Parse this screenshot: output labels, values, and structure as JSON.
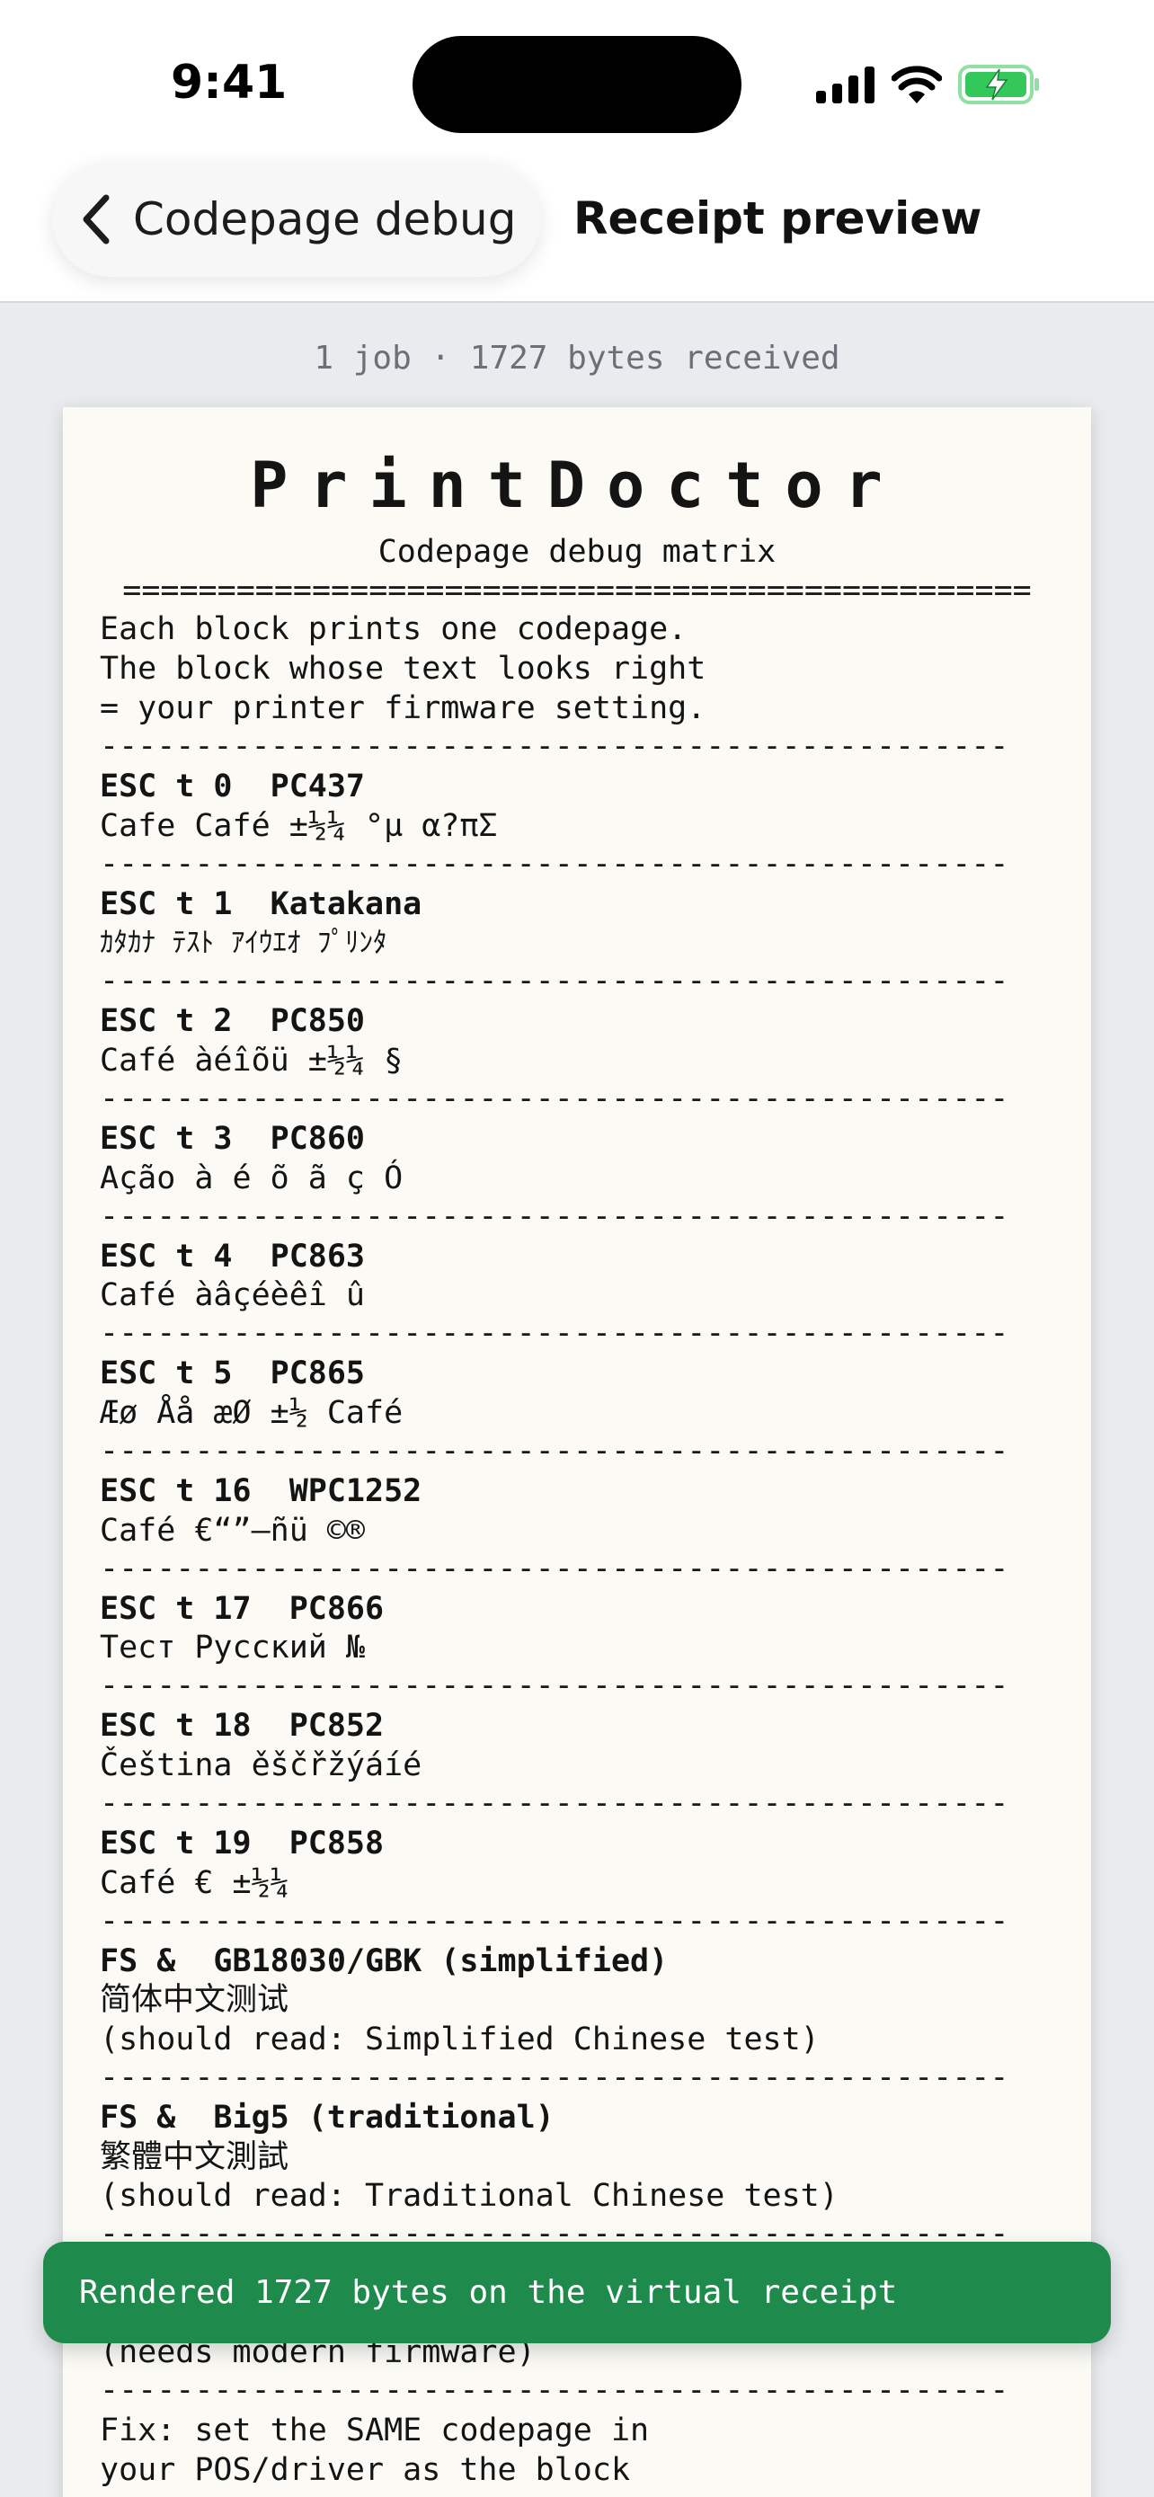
{
  "status_bar": {
    "time": "9:41",
    "signal_icon": "cellular-signal-icon",
    "wifi_icon": "wifi-icon",
    "battery_icon": "battery-charging-icon",
    "battery_color": "#34c759"
  },
  "nav": {
    "back_label": "Codepage debug",
    "title": "Receipt preview"
  },
  "summary": "1 job · 1727 bytes received",
  "receipt": {
    "brand": "PrintDoctor",
    "subtitle": "Codepage debug matrix",
    "double_rule": "================================================",
    "rule": "------------------------------------------------",
    "intro": [
      "Each block prints one codepage.",
      "The block whose text looks right",
      "= your printer firmware setting."
    ],
    "blocks": [
      {
        "header": "ESC t 0  PC437",
        "lines": [
          "Cafe Café ±½¼ °µ α?πΣ"
        ]
      },
      {
        "header": "ESC t 1  Katakana",
        "lines": [
          "ｶﾀｶﾅ ﾃｽﾄ ｱｲｳｴｵ ﾌﾟﾘﾝﾀ"
        ]
      },
      {
        "header": "ESC t 2  PC850",
        "lines": [
          "Café àéîõü ±½¼ §"
        ]
      },
      {
        "header": "ESC t 3  PC860",
        "lines": [
          "Ação à é õ ã ç Ó"
        ]
      },
      {
        "header": "ESC t 4  PC863",
        "lines": [
          "Café àâçéèêî û"
        ]
      },
      {
        "header": "ESC t 5  PC865",
        "lines": [
          "Æø Åå æØ ±½ Café"
        ]
      },
      {
        "header": "ESC t 16  WPC1252",
        "lines": [
          "Café €“”—ñü ©®"
        ]
      },
      {
        "header": "ESC t 17  PC866",
        "lines": [
          "Тест Русский №"
        ]
      },
      {
        "header": "ESC t 18  PC852",
        "lines": [
          "Čeština ěščřžýáíé"
        ]
      },
      {
        "header": "ESC t 19  PC858",
        "lines": [
          "Café € ±½¼"
        ]
      },
      {
        "header": "FS &  GB18030/GBK (simplified)",
        "lines": [
          "简体中文测试",
          "(should read: Simplified Chinese test)"
        ]
      },
      {
        "header": "FS &  Big5 (traditional)",
        "lines": [
          "繁體中文測試",
          "(should read: Traditional Chinese test)"
        ]
      }
    ],
    "partial_line": "(needs modern firmware)",
    "fix_lines": [
      "Fix: set the SAME codepage in",
      "your POS/driver as the block"
    ]
  },
  "toast": {
    "message": "Rendered 1727 bytes on the virtual receipt",
    "color": "#1e8a4c"
  }
}
